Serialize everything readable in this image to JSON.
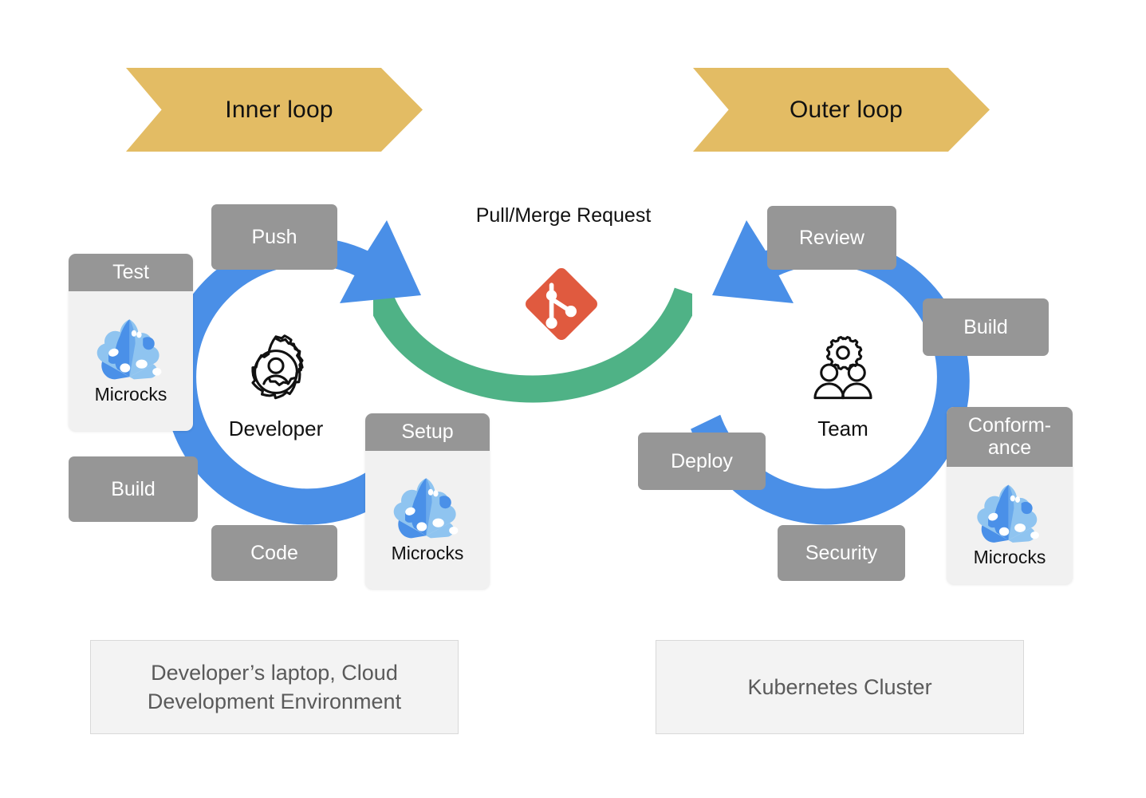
{
  "banners": {
    "inner": "Inner loop",
    "outer": "Outer loop",
    "color": "#e3bc64"
  },
  "colors": {
    "arrow_blue": "#4a8fe7",
    "connector_green": "#4fb286",
    "chip_gray": "#969696",
    "card_gray": "#f1f1f1",
    "git_red": "#e05a3f",
    "microcks_dark": "#4a90e8",
    "microcks_light": "#8fc4f0"
  },
  "inner_loop": {
    "center": {
      "label": "Developer",
      "icon": "gear-person-icon"
    },
    "steps": [
      {
        "id": "push",
        "label": "Push"
      },
      {
        "id": "test",
        "label": "Test"
      },
      {
        "id": "build",
        "label": "Build"
      },
      {
        "id": "code",
        "label": "Code"
      },
      {
        "id": "setup",
        "label": "Setup"
      }
    ],
    "tool_cards": [
      {
        "step": "Test",
        "tool": "Microcks"
      },
      {
        "step": "Setup",
        "tool": "Microcks"
      }
    ],
    "environment": "Developer’s laptop, Cloud Development Environment"
  },
  "outer_loop": {
    "center": {
      "label": "Team",
      "icon": "team-gear-icon"
    },
    "steps": [
      {
        "id": "review",
        "label": "Review"
      },
      {
        "id": "build",
        "label": "Build"
      },
      {
        "id": "conformance",
        "label_line1": "Conform-",
        "label_line2": "ance"
      },
      {
        "id": "security",
        "label": "Security"
      },
      {
        "id": "deploy",
        "label": "Deploy"
      }
    ],
    "tool_cards": [
      {
        "step": "Conformance",
        "tool": "Microcks"
      }
    ],
    "environment": "Kubernetes Cluster"
  },
  "bridge": {
    "label": "Pull/Merge Request",
    "icon": "git-logo-icon"
  },
  "chart_data": {
    "type": "diagram",
    "title": "Microcks in the inner and outer development loops",
    "nodes": [
      "Inner loop",
      "Outer loop",
      "Push",
      "Test",
      "Build",
      "Code",
      "Setup",
      "Developer",
      "Review",
      "Build",
      "Conformance",
      "Security",
      "Deploy",
      "Team",
      "Pull/Merge Request",
      "Developer’s laptop, Cloud Development Environment",
      "Kubernetes Cluster"
    ],
    "edges": [
      {
        "from": "Inner loop",
        "to": "Pull/Merge Request",
        "style": "green-curve"
      },
      {
        "from": "Pull/Merge Request",
        "to": "Outer loop",
        "style": "green-curve"
      }
    ]
  }
}
